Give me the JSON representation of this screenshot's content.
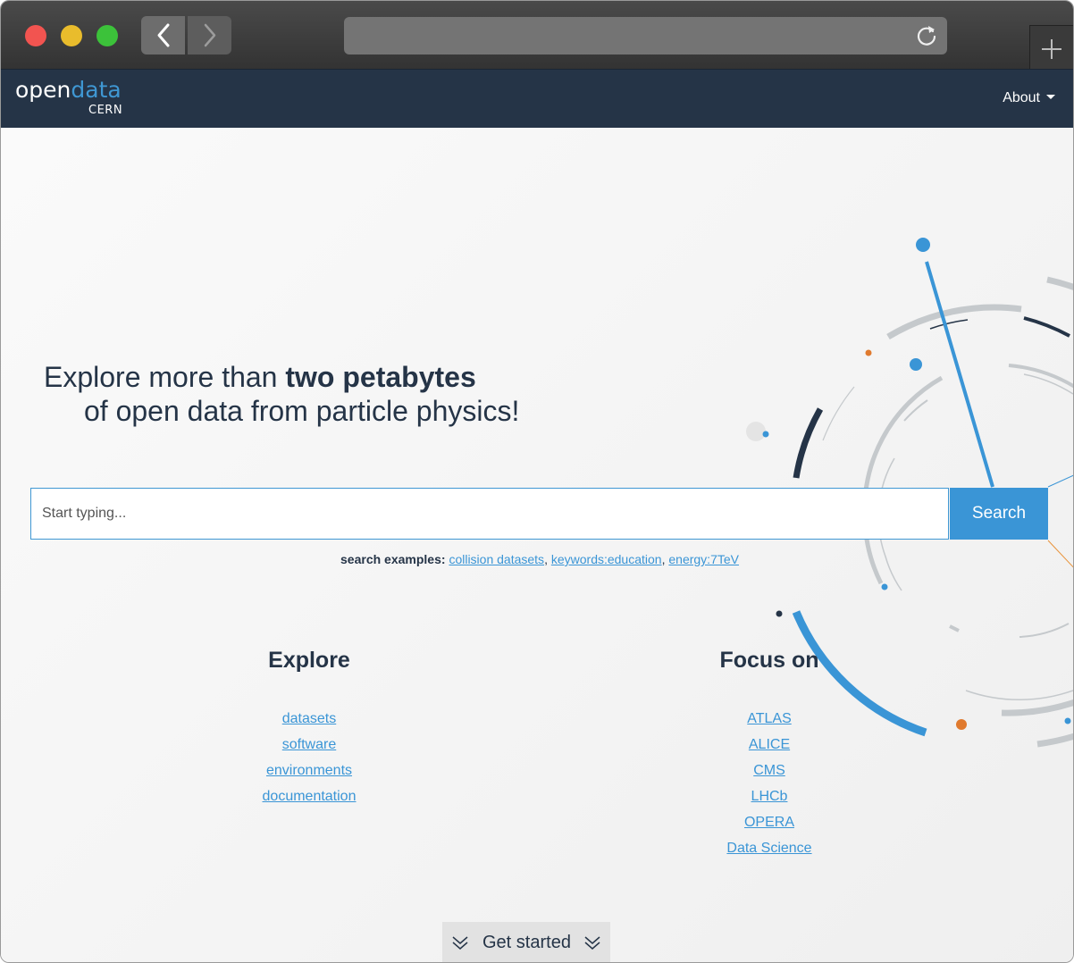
{
  "browser": {
    "window_controls": [
      "close",
      "minimize",
      "zoom"
    ],
    "back_icon": "chevron-left-icon",
    "forward_icon": "chevron-right-icon",
    "url": "",
    "reload_icon": "reload-icon",
    "newtab_icon": "plus-icon"
  },
  "site": {
    "logo_word1": "open",
    "logo_word2": "data",
    "logo_sub": "CERN",
    "about_label": "About",
    "brand_color": "#253447",
    "accent_color": "#3a95d6"
  },
  "hero": {
    "line1_prefix": "Explore more than ",
    "line1_bold": "two petabytes",
    "line2": "of open data from particle physics!"
  },
  "search": {
    "placeholder": "Start typing...",
    "button_label": "Search",
    "examples_label": "search examples:",
    "examples": [
      "collision datasets",
      "keywords:education",
      "energy:7TeV"
    ]
  },
  "explore": {
    "title": "Explore",
    "links": [
      "datasets",
      "software",
      "environments",
      "documentation"
    ]
  },
  "focus": {
    "title": "Focus on",
    "links": [
      "ATLAS",
      "ALICE",
      "CMS",
      "LHCb",
      "OPERA",
      "Data Science"
    ]
  },
  "get_started": {
    "label": "Get started"
  }
}
